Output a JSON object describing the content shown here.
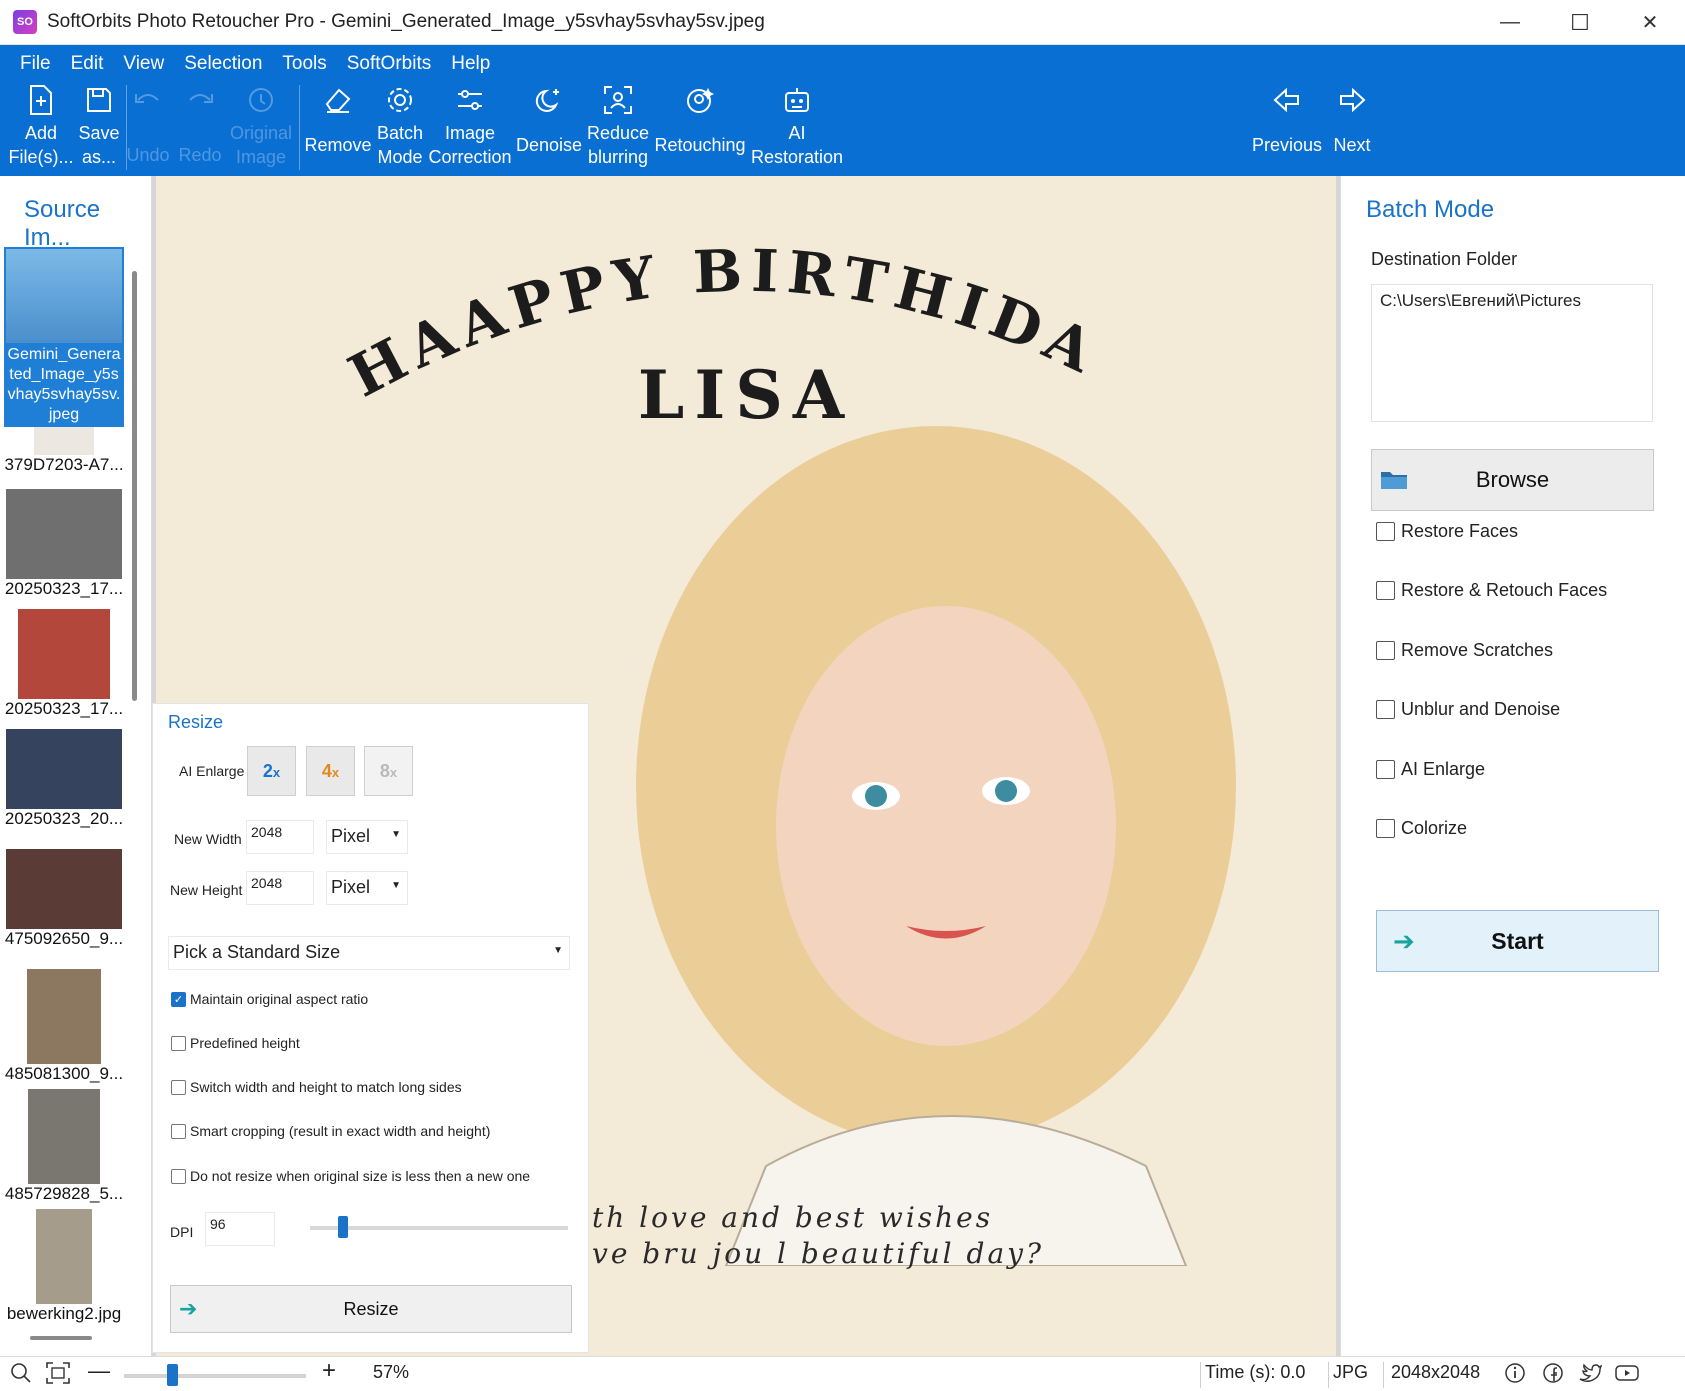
{
  "window": {
    "title": "SoftOrbits Photo Retoucher Pro - Gemini_Generated_Image_y5svhay5svhay5sv.jpeg",
    "minimize": "—",
    "maximize": "☐",
    "close": "✕"
  },
  "menu": [
    "File",
    "Edit",
    "View",
    "Selection",
    "Tools",
    "SoftOrbits",
    "Help"
  ],
  "toolbar": {
    "add_files": "Add\nFile(s)...",
    "save_as": "Save\nas...",
    "undo": "Undo",
    "redo": "Redo",
    "original_image": "Original\nImage",
    "remove": "Remove",
    "batch_mode": "Batch\nMode",
    "image_correction": "Image\nCorrection",
    "denoise": "Denoise",
    "reduce_blurring": "Reduce\nblurring",
    "retouching": "Retouching",
    "ai_restoration": "AI\nRestoration",
    "previous": "Previous",
    "next": "Next"
  },
  "source_panel": {
    "title": "Source Im...",
    "selected_label": "Gemini_Generated_Image_y5svhay5svhay5sv.jpeg",
    "items": [
      {
        "label": "379D7203-A7...",
        "tone": "#ece7e0"
      },
      {
        "label": "20250323_17...",
        "tone": "#6f6f6f"
      },
      {
        "label": "20250323_17...",
        "tone": "#b3473c"
      },
      {
        "label": "20250323_20...",
        "tone": "#35435e"
      },
      {
        "label": "475092650_9...",
        "tone": "#5b3b36"
      },
      {
        "label": "485081300_9...",
        "tone": "#8c7760"
      },
      {
        "label": "485729828_5...",
        "tone": "#7a7670"
      },
      {
        "label": "bewerking2.jpg",
        "tone": "#a59c8c"
      }
    ]
  },
  "canvas": {
    "greeting": "HAAPPY BIRTHIDAY",
    "name": "LISA",
    "message_line1": "th love and best wishes",
    "message_line2": "ve bru jou l beautiful day?"
  },
  "resize": {
    "title": "Resize",
    "ai_enlarge_label": "AI Enlarge",
    "enlarge_options": [
      {
        "num": "2",
        "suffix": "x",
        "color": "#1a73c8"
      },
      {
        "num": "4",
        "suffix": "x",
        "color": "#e08a1e"
      },
      {
        "num": "8",
        "suffix": "x",
        "color": "#b9b9b9"
      }
    ],
    "new_width_label": "New Width",
    "new_width": "2048",
    "width_unit": "Pixel",
    "new_height_label": "New Height",
    "new_height": "2048",
    "height_unit": "Pixel",
    "standard_size": "Pick a Standard Size",
    "options": [
      {
        "label": "Maintain original aspect ratio",
        "checked": true
      },
      {
        "label": "Predefined height",
        "checked": false
      },
      {
        "label": "Switch width and height to match long sides",
        "checked": false
      },
      {
        "label": "Smart cropping (result in exact width and height)",
        "checked": false
      },
      {
        "label": "Do not resize when original size is less then a new one",
        "checked": false
      }
    ],
    "dpi_label": "DPI",
    "dpi": "96",
    "button": "Resize"
  },
  "batch": {
    "title": "Batch Mode",
    "destination_label": "Destination Folder",
    "destination_path": "C:\\Users\\Евгений\\Pictures",
    "browse": "Browse",
    "options": [
      {
        "label": "Restore Faces",
        "checked": false
      },
      {
        "label": "Restore & Retouch Faces",
        "checked": false
      },
      {
        "label": "Remove Scratches",
        "checked": false
      },
      {
        "label": "Unblur and Denoise",
        "checked": false
      },
      {
        "label": "AI Enlarge",
        "checked": false
      },
      {
        "label": "Colorize",
        "checked": false
      }
    ],
    "start": "Start"
  },
  "status": {
    "zoom": "57%",
    "zoom_level": 0.57,
    "time": "Time (s): 0.0",
    "format": "JPG",
    "dimensions": "2048x2048"
  },
  "colors": {
    "ribbon": "#0a6fd3",
    "accent": "#1a73c8",
    "selection": "#1f7fd6",
    "start_bg": "#e3f1fb"
  }
}
